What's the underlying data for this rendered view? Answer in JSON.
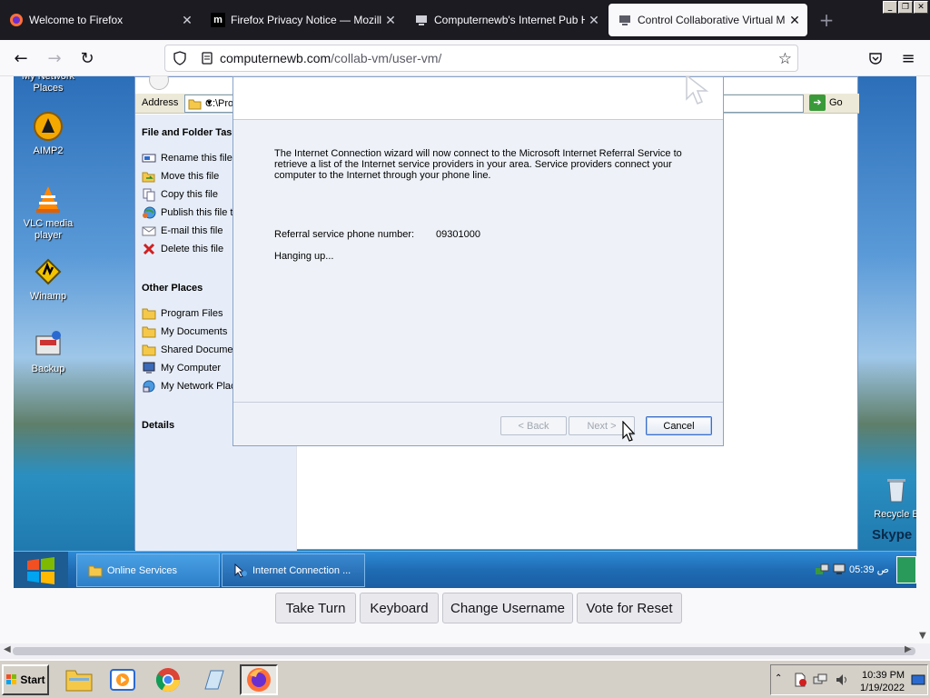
{
  "browser": {
    "tabs": [
      {
        "title": "Welcome to Firefox",
        "icon": "firefox-icon"
      },
      {
        "title": "Firefox Privacy Notice — Mozilla",
        "icon": "mozilla-m-icon",
        "icon_text": "m"
      },
      {
        "title": "Computernewb's Internet Pub Hub",
        "icon": "computernewb-icon"
      },
      {
        "title": "Control Collaborative Virtual Machi",
        "icon": "computernewb-icon",
        "active": true
      }
    ],
    "url": {
      "host": "computernewb.com",
      "path": "/collab-vm/user-vm/"
    }
  },
  "vm": {
    "desktop_icons": [
      {
        "label": "My Network Places",
        "icon": "network-places-icon"
      },
      {
        "label": "AIMP2",
        "icon": "aimp-icon"
      },
      {
        "label": "VLC media player",
        "icon": "vlc-icon"
      },
      {
        "label": "Winamp",
        "icon": "winamp-icon"
      },
      {
        "label": "Backup",
        "icon": "backup-icon"
      },
      {
        "label": "Recycle B",
        "icon": "recycle-bin-icon"
      },
      {
        "label": "Skype",
        "icon": "skype-icon"
      }
    ],
    "explorer": {
      "address_label": "Address",
      "address_value": "C:\\Prog",
      "go_label": "Go",
      "file_tasks_heading": "File and Folder Tas",
      "file_tasks": [
        {
          "label": "Rename this file",
          "icon": "rename-icon"
        },
        {
          "label": "Move this file",
          "icon": "move-icon"
        },
        {
          "label": "Copy this file",
          "icon": "copy-icon"
        },
        {
          "label": "Publish this file t",
          "icon": "publish-web-icon"
        },
        {
          "label": "E-mail this file",
          "icon": "email-icon"
        },
        {
          "label": "Delete this file",
          "icon": "delete-icon"
        }
      ],
      "other_places_heading": "Other Places",
      "other_places": [
        {
          "label": "Program Files",
          "icon": "folder-icon"
        },
        {
          "label": "My Documents",
          "icon": "folder-icon"
        },
        {
          "label": "Shared Documer",
          "icon": "folder-icon"
        },
        {
          "label": "My Computer",
          "icon": "computer-icon"
        },
        {
          "label": "My Network Plac",
          "icon": "network-icon"
        }
      ],
      "details_heading": "Details"
    },
    "dialog": {
      "description": "The Internet Connection wizard will now connect to the Microsoft Internet Referral Service to retrieve a list of the Internet service providers in your area. Service providers connect your computer to the Internet through your phone line.",
      "phone_label": "Referral service phone number:",
      "phone_value": "09301000",
      "status": "Hanging up...",
      "back_label": "< Back",
      "next_label": "Next >",
      "cancel_label": "Cancel"
    },
    "taskbar": {
      "tasks": [
        {
          "label": "Online Services",
          "icon": "folder-icon"
        },
        {
          "label": "Internet Connection ...",
          "icon": "internet-connection-icon"
        }
      ],
      "clock": "05:39 ص"
    }
  },
  "page_buttons": [
    "Take Turn",
    "Keyboard",
    "Change Username",
    "Vote for Reset"
  ],
  "host_taskbar": {
    "start_label": "Start",
    "time": "10:39 PM",
    "date": "1/19/2022"
  }
}
